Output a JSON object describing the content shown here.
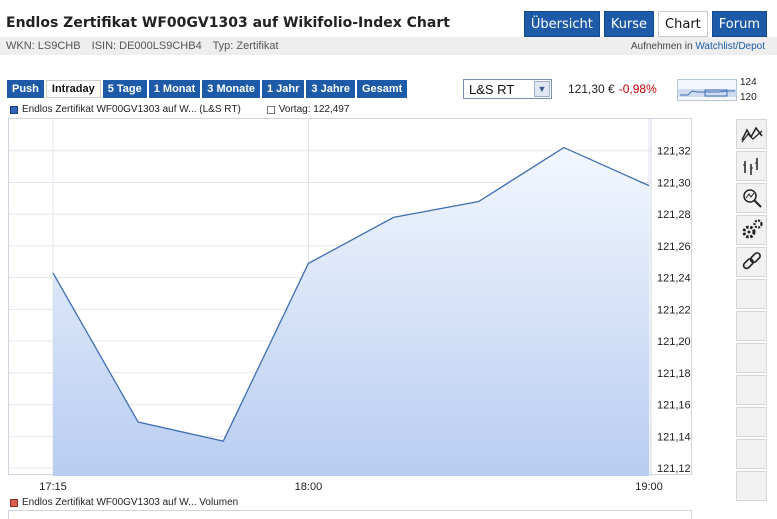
{
  "header": {
    "title": "Endlos Zertifikat WF00GV1303 auf Wikifolio-Index Chart",
    "tabs": [
      {
        "label": "Übersicht",
        "active": false
      },
      {
        "label": "Kurse",
        "active": false
      },
      {
        "label": "Chart",
        "active": true
      },
      {
        "label": "Forum",
        "active": false
      }
    ]
  },
  "info": {
    "wkn": "WKN: LS9CHB",
    "isin": "ISIN: DE000LS9CHB4",
    "typ": "Typ: Zertifikat",
    "aufnehmen": "Aufnehmen in",
    "watchlist_link": "Watchlist/Depot"
  },
  "ranges": [
    {
      "label": "Push",
      "active": false
    },
    {
      "label": "Intraday",
      "active": true
    },
    {
      "label": "5 Tage",
      "active": false
    },
    {
      "label": "1 Monat",
      "active": false
    },
    {
      "label": "3 Monate",
      "active": false
    },
    {
      "label": "1 Jahr",
      "active": false
    },
    {
      "label": "3 Jahre",
      "active": false
    },
    {
      "label": "Gesamt",
      "active": false
    }
  ],
  "exchange_select": {
    "value": "L&S RT"
  },
  "quote": {
    "price": "121,30 €",
    "change": "-0,98%"
  },
  "mini_chart": {
    "high_label": "124",
    "low_label": "120"
  },
  "legend": {
    "series": "Endlos Zertifikat WF00GV1303 auf W... (L&S RT)",
    "vortag": "Vortag: 122,497",
    "volume": "Endlos Zertifikat WF00GV1303 auf W... Volumen"
  },
  "toolbar_icons": [
    "line-chart-icon",
    "ohlc-bars-icon",
    "zoom-icon",
    "settings-gears-icon",
    "link-icon"
  ],
  "colors": {
    "accent": "#1d5aa8",
    "negative": "#c00000",
    "line": "#3f6eb0",
    "fill_top": "#f3f7fe",
    "fill_bottom": "#b8cdf1"
  },
  "chart_data": {
    "type": "area",
    "x": [
      "17:15",
      "17:30",
      "17:45",
      "18:00",
      "18:15",
      "18:30",
      "18:45",
      "19:00"
    ],
    "values": [
      121.243,
      121.149,
      121.137,
      121.249,
      121.278,
      121.288,
      121.322,
      121.298
    ],
    "xticks": [
      "17:15",
      "18:00",
      "19:00"
    ],
    "ylim": [
      121.115,
      121.34
    ],
    "yticks": [
      "121,12",
      "121,14",
      "121,16",
      "121,18",
      "121,20",
      "121,22",
      "121,24",
      "121,26",
      "121,28",
      "121,30",
      "121,32"
    ],
    "ytick_values": [
      121.12,
      121.14,
      121.16,
      121.18,
      121.2,
      121.22,
      121.24,
      121.26,
      121.28,
      121.3,
      121.32
    ],
    "grid": true
  }
}
